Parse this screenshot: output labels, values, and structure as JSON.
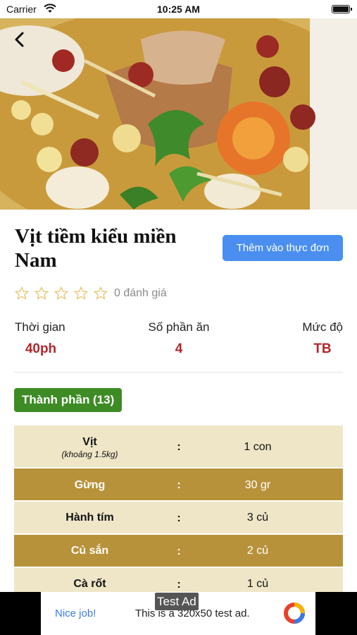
{
  "status_bar": {
    "carrier": "Carrier",
    "time": "10:25 AM"
  },
  "recipe": {
    "title": "Vịt tiềm kiểu miền Nam",
    "add_button": "Thêm vào thực đơn",
    "rating": {
      "stars_filled": 0,
      "stars_total": 5,
      "count_text": "0 đánh giá"
    },
    "info": {
      "time_label": "Thời gian",
      "time_value": "40ph",
      "servings_label": "Số phần ăn",
      "servings_value": "4",
      "difficulty_label": "Mức độ",
      "difficulty_value": "TB"
    }
  },
  "ingredients": {
    "header": "Thành phần (13)",
    "rows": [
      {
        "name": "Vịt",
        "note": "(khoảng 1.5kg)",
        "sep": ":",
        "qty": "1 con"
      },
      {
        "name": "Gừng",
        "note": "",
        "sep": ":",
        "qty": "30 gr"
      },
      {
        "name": "Hành tím",
        "note": "",
        "sep": ":",
        "qty": "3 củ"
      },
      {
        "name": "Củ sắn",
        "note": "",
        "sep": ":",
        "qty": "2 củ"
      },
      {
        "name": "Cà rốt",
        "note": "",
        "sep": ":",
        "qty": "1 củ"
      }
    ]
  },
  "ad": {
    "label": "Test Ad",
    "nice": "Nice job!",
    "text": "This is a 320x50 test ad."
  },
  "colors": {
    "accent_blue": "#4a8ff0",
    "value_red": "#b3262b",
    "badge_green": "#3d8b25",
    "row_light": "#efe6c8",
    "row_dark": "#b8923a"
  }
}
